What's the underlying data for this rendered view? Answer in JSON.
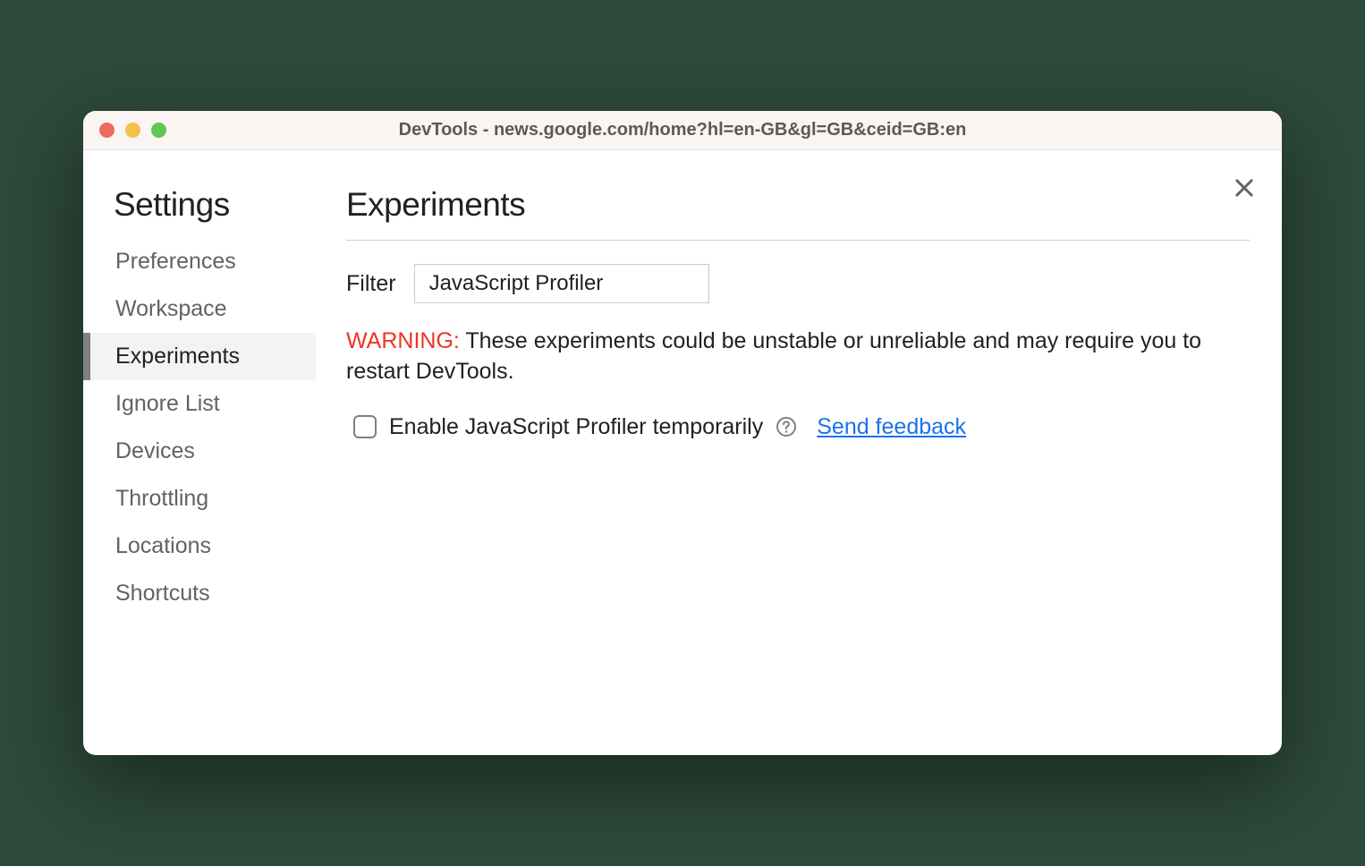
{
  "window": {
    "title": "DevTools - news.google.com/home?hl=en-GB&gl=GB&ceid=GB:en"
  },
  "sidebar": {
    "title": "Settings",
    "items": [
      {
        "label": "Preferences",
        "active": false
      },
      {
        "label": "Workspace",
        "active": false
      },
      {
        "label": "Experiments",
        "active": true
      },
      {
        "label": "Ignore List",
        "active": false
      },
      {
        "label": "Devices",
        "active": false
      },
      {
        "label": "Throttling",
        "active": false
      },
      {
        "label": "Locations",
        "active": false
      },
      {
        "label": "Shortcuts",
        "active": false
      }
    ]
  },
  "main": {
    "title": "Experiments",
    "filter_label": "Filter",
    "filter_value": "JavaScript Profiler",
    "warning_label": "WARNING:",
    "warning_text": " These experiments could be unstable or unreliable and may require you to restart DevTools.",
    "experiment": {
      "checked": false,
      "label": "Enable JavaScript Profiler temporarily",
      "feedback_link": "Send feedback"
    }
  }
}
